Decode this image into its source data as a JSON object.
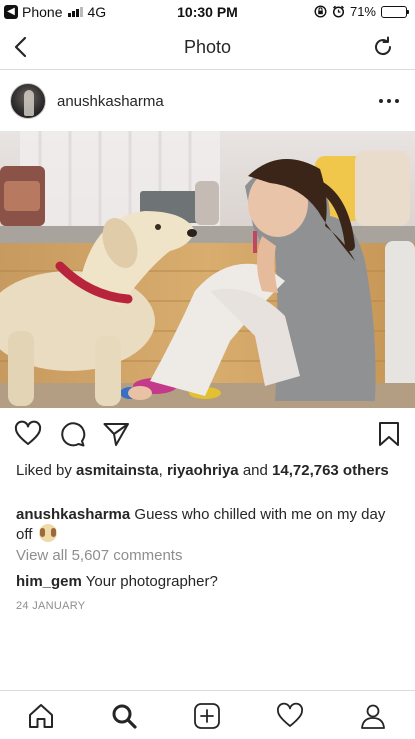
{
  "status_bar": {
    "carrier": "Phone",
    "network": "4G",
    "time": "10:30 PM",
    "battery_percent": "71%",
    "battery_level": 0.71
  },
  "nav": {
    "title": "Photo"
  },
  "post": {
    "username": "anushkasharma",
    "likes_prefix": "Liked by ",
    "liker_1": "asmitainsta",
    "liker_sep": ", ",
    "liker_2": "riyaohriya",
    "likes_and": " and ",
    "likes_count": "14,72,763 others",
    "caption_user": "anushkasharma",
    "caption_text": " Guess who chilled with me on my day off ",
    "view_comments": "View all 5,607 comments",
    "comment_user": "him_gem",
    "comment_text": " Your photographer?",
    "date": "24 JANUARY"
  },
  "icons": {
    "back": "chevron-left-icon",
    "refresh": "refresh-icon",
    "more": "more-horizontal-icon",
    "like": "heart-icon",
    "comment": "comment-icon",
    "share": "send-icon",
    "save": "bookmark-icon",
    "home": "home-icon",
    "search": "search-icon",
    "add": "add-post-icon",
    "activity": "heart-icon",
    "profile": "profile-icon"
  },
  "colors": {
    "text": "#262626",
    "muted": "#8e8e8e",
    "divider": "#dbdbdb"
  }
}
